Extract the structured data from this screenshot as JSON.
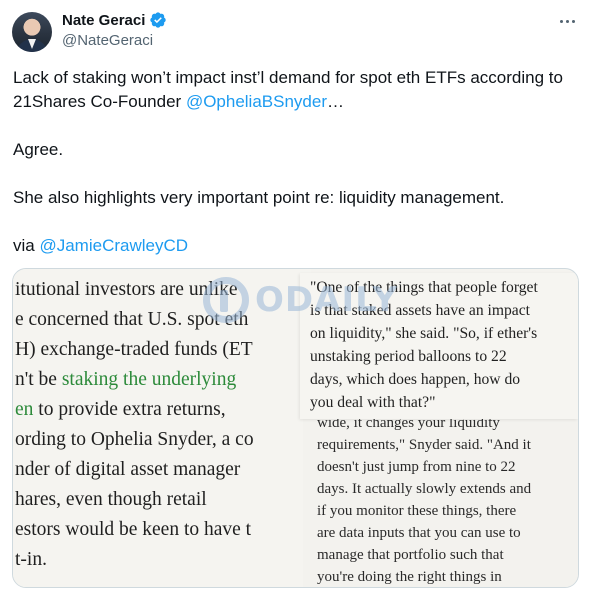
{
  "author": {
    "name": "Nate Geraci",
    "handle": "@NateGeraci",
    "verified": true,
    "avatar_icon": "user-avatar"
  },
  "colors": {
    "accent": "#1d9bf0",
    "text": "#0f1419",
    "muted": "#536471",
    "border": "#cfd9de",
    "quote_green": "#2c8a3a"
  },
  "tweet": {
    "line1_text": "Lack of staking won’t impact inst’l demand for spot eth ETFs according to 21Shares Co-Founder ",
    "line1_mention": "@OpheliaBSnyder",
    "line1_suffix": "…",
    "para2": "Agree.",
    "para3": "She also highlights very important point re: liquidity management.",
    "para4_prefix": "via ",
    "para4_mention": "@JamieCrawleyCD"
  },
  "media": {
    "watermark": "ODAILY",
    "left_lines": [
      "itutional investors are unlike",
      "e concerned that U.S. spot eth",
      "H) exchange-traded funds (ET",
      "n't be staking the underlying",
      "en to provide extra returns,",
      "ording to Ophelia Snyder, a co",
      "nder of digital asset manager",
      "hares, even though retail",
      "estors would be keen to have t",
      "t-in."
    ],
    "left_green_1": "staking the underlying",
    "left_green_2": "en",
    "right_top_lines": [
      "\"One of the things that people forget",
      "is that staked assets have an impact",
      "on liquidity,\" she said. \"So, if ether's",
      "unstaking period balloons to 22",
      "days, which does happen, how do",
      "you deal with that?\""
    ],
    "right_bottom_lines": [
      "wide, it changes your liquidity",
      "requirements,\" Snyder said. \"And it",
      "doesn't just jump from nine to 22",
      "days. It actually slowly extends and",
      "if you monitor these things, there",
      "are data inputs that you can use to",
      "manage that portfolio such that",
      "you're doing the right things in"
    ]
  }
}
